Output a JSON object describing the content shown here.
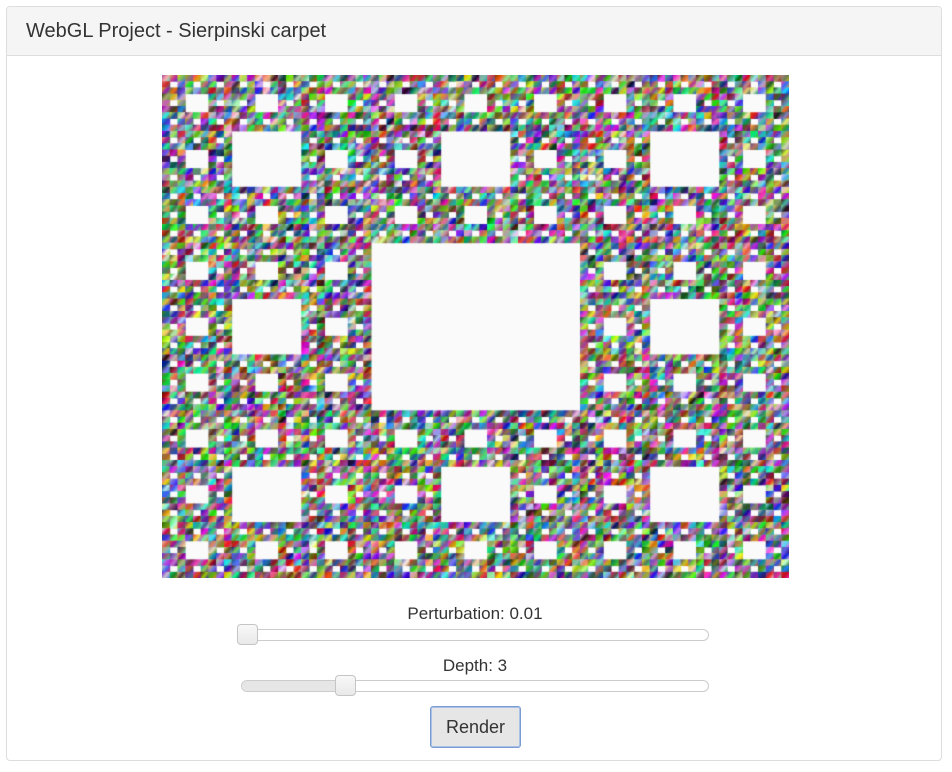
{
  "panel": {
    "title": "WebGL Project - Sierpinski carpet"
  },
  "controls": {
    "perturbation_label": "Perturbation: 0.01",
    "perturbation_fraction": 0.01,
    "depth_label": "Depth: 3",
    "depth_fraction": 0.22,
    "render_label": "Render"
  },
  "colors": {
    "page_background": "#ffffff",
    "panel_heading_background": "#f5f5f5",
    "panel_border": "#dddddd",
    "carpet_hole": "#fafafa",
    "button_background": "#e6e6e6",
    "button_focus_border": "#7a9cd3"
  },
  "render": {
    "depth": 3,
    "perturbation": 0.01
  }
}
